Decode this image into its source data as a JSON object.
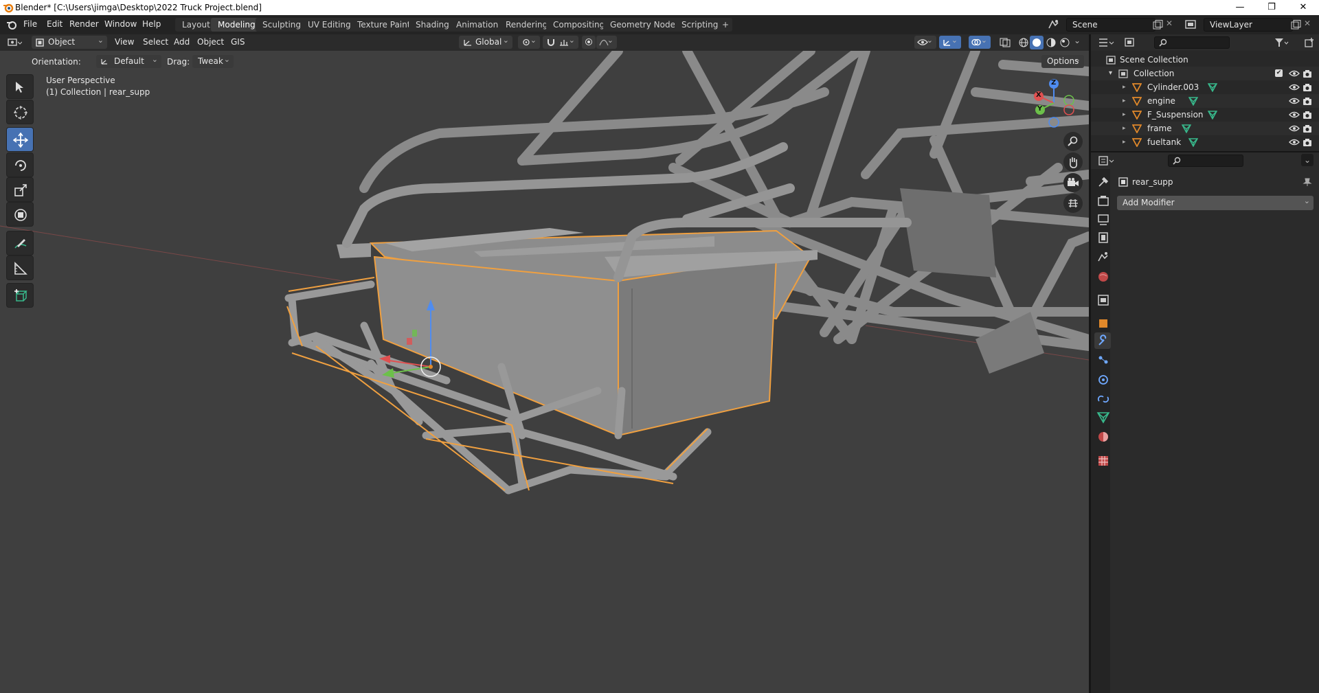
{
  "titlebar": {
    "title": "Blender* [C:\\Users\\jimga\\Desktop\\2022 Truck Project.blend]",
    "min": "—",
    "max": "❐",
    "close": "✕"
  },
  "menubar": {
    "items": [
      "File",
      "Edit",
      "Render",
      "Window",
      "Help"
    ]
  },
  "workspaces": [
    "Layout",
    "Modeling",
    "Sculpting",
    "UV Editing",
    "Texture Paint",
    "Shading",
    "Animation",
    "Rendering",
    "Compositing",
    "Geometry Nodes",
    "Scripting"
  ],
  "workspace_add": "+",
  "scene": {
    "scene_name": "Scene",
    "view_layer": "ViewLayer"
  },
  "header3d": {
    "mode": "Object Mode",
    "menus": [
      "View",
      "Select",
      "Add",
      "Object",
      "GIS"
    ],
    "transform_orientation": "Global"
  },
  "tool_options": {
    "orientation_label": "Orientation:",
    "orientation_value": "Default",
    "drag_label": "Drag:",
    "drag_value": "Tweak",
    "options": "Options"
  },
  "viewport": {
    "perspective": "User Perspective",
    "collection_info": "(1) Collection | rear_supp",
    "gizmo_x": "X",
    "gizmo_y": "Y",
    "gizmo_z": "Z"
  },
  "outliner": {
    "root": "Scene Collection",
    "collection": "Collection",
    "items": [
      "Cylinder.003",
      "engine",
      "F_Suspension",
      "frame",
      "fueltank"
    ]
  },
  "properties": {
    "object_name": "rear_supp",
    "add_modifier": "Add Modifier"
  },
  "colors": {
    "accent": "#4772b3",
    "selection": "#f0a040",
    "object_orange": "#e0882a",
    "mesh_green": "#38b98c"
  }
}
